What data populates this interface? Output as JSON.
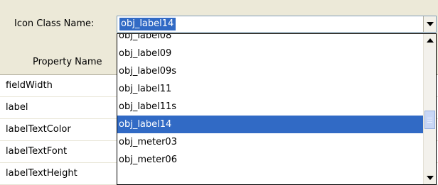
{
  "label": {
    "text": "Icon Class Name:"
  },
  "combo": {
    "value": "obj_label14"
  },
  "grid": {
    "header": "Property Name",
    "rows": [
      {
        "name": "fieldWidth"
      },
      {
        "name": "label"
      },
      {
        "name": "labelTextColor"
      },
      {
        "name": "labelTextFont"
      },
      {
        "name": "labelTextHeight"
      }
    ]
  },
  "dropdown": {
    "items": [
      {
        "text": "obj_label08"
      },
      {
        "text": "obj_label09"
      },
      {
        "text": "obj_label09s"
      },
      {
        "text": "obj_label11"
      },
      {
        "text": "obj_label11s"
      },
      {
        "text": "obj_label14"
      },
      {
        "text": "obj_meter03"
      },
      {
        "text": "obj_meter06"
      }
    ],
    "selected_index": 5,
    "scroll_position": 0.6
  },
  "colors": {
    "highlight": "#316ac5",
    "window_bg": "#ece9d8"
  }
}
